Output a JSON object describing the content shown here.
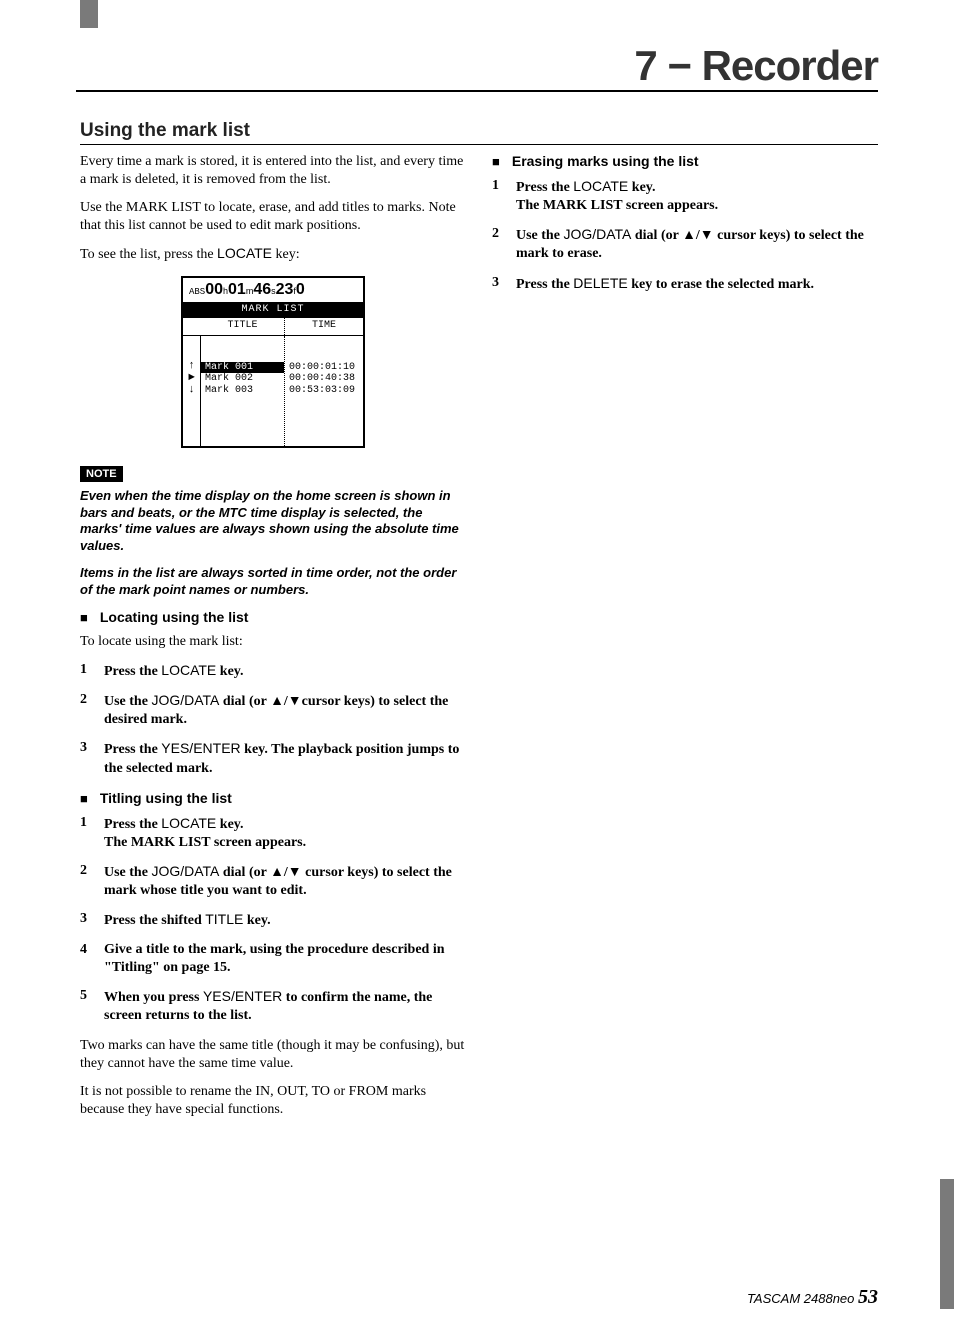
{
  "header": {
    "title": "7 − Recorder"
  },
  "section": {
    "title": "Using the mark list"
  },
  "intro": {
    "p1": "Every time a mark is stored, it is entered into the list, and every time a mark is deleted, it is removed from the list.",
    "p2": "Use the MARK LIST to locate, erase, and add titles to marks. Note that this list cannot be used to edit mark positions.",
    "p3_pre": "To see the list, press the ",
    "p3_key": "LOCATE",
    "p3_post": " key:"
  },
  "figure": {
    "abs_label": "ABS",
    "time_h": "00",
    "time_h_u": "h",
    "time_m": "01",
    "time_m_u": "m",
    "time_s": "46",
    "time_s_u": "s",
    "time_f": "23",
    "time_f_u": "f",
    "time_sub": "0",
    "bar_label": "MARK LIST",
    "col_title": "TITLE",
    "col_time": "TIME",
    "rows": [
      {
        "title": "Mark 001",
        "time": "00:00:01:10",
        "selected": true
      },
      {
        "title": "Mark 002",
        "time": "00:00:40:38",
        "selected": false
      },
      {
        "title": "Mark 003",
        "time": "00:53:03:09",
        "selected": false
      }
    ]
  },
  "note": {
    "badge": "NOTE",
    "p1": "Even when the time display on the home screen is shown in bars and beats, or the MTC time display is selected, the marks' time values are always shown using the absolute time values.",
    "p2": "Items in the list are always sorted in time order, not the order of the mark point names or numbers."
  },
  "locating": {
    "title": "Locating using the list",
    "intro": "To locate using the mark list:",
    "s1_pre": "Press the ",
    "s1_key": "LOCATE",
    "s1_post": " key.",
    "s2_pre": "Use the ",
    "s2_key": "JOG/DATA",
    "s2_mid": " dial (or ▲/▼cursor keys) to select the desired mark.",
    "s3_pre": "Press the ",
    "s3_key": "YES/ENTER",
    "s3_post": " key. The playback position jumps to the selected mark."
  },
  "titling": {
    "title": "Titling using the list",
    "s1_pre": "Press the ",
    "s1_key": "LOCATE",
    "s1_post": " key.",
    "s1_line2": "The MARK LIST screen appears.",
    "s2_pre": "Use the ",
    "s2_key": "JOG/DATA",
    "s2_post": " dial (or ▲/▼ cursor keys) to select the mark whose title you want to edit.",
    "s3_pre": "Press the shifted ",
    "s3_key": "TITLE",
    "s3_post": " key.",
    "s4": "Give a title to the mark, using the procedure described in \"Titling\" on page 15.",
    "s5_pre": "When you press ",
    "s5_key": "YES/ENTER",
    "s5_post": " to confirm the name, the screen returns to the list.",
    "tail_p1": "Two marks can have the same title (though it may be confusing), but they cannot have the same time value.",
    "tail_p2": "It is not possible to rename the IN, OUT, TO or FROM marks because they have special functions."
  },
  "erasing": {
    "title": "Erasing marks using the list",
    "s1_pre": "Press the ",
    "s1_key": "LOCATE",
    "s1_post": " key.",
    "s1_line2": "The MARK LIST screen appears.",
    "s2_pre": "Use the ",
    "s2_key": "JOG/DATA",
    "s2_post": " dial (or ▲/▼ cursor keys) to select the mark to erase.",
    "s3_pre": "Press the ",
    "s3_key": "DELETE",
    "s3_post": " key to erase the selected mark."
  },
  "footer": {
    "brand": "TASCAM  2488neo ",
    "page": "53"
  }
}
